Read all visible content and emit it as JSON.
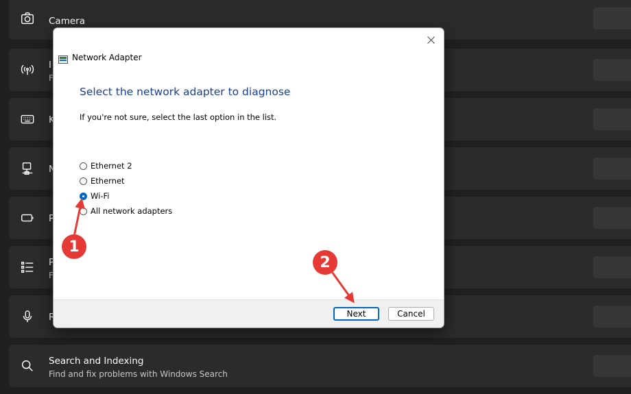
{
  "settings_rows": [
    {
      "title": "Camera",
      "subtitle": "",
      "icon": "camera-icon"
    },
    {
      "title": "I",
      "subtitle": "F",
      "icon": "antenna-icon"
    },
    {
      "title": "K",
      "subtitle": "",
      "icon": "keyboard-icon"
    },
    {
      "title": "N",
      "subtitle": "",
      "icon": "network-adapter-icon"
    },
    {
      "title": "P",
      "subtitle": "",
      "icon": "power-icon"
    },
    {
      "title": "P",
      "subtitle": "F",
      "icon": "list-icon"
    },
    {
      "title": "R",
      "subtitle": "",
      "icon": "microphone-icon"
    },
    {
      "title": "Search and Indexing",
      "subtitle": "Find and fix problems with Windows Search",
      "icon": "search-icon"
    }
  ],
  "dialog": {
    "window_title": "Network Adapter",
    "heading": "Select the network adapter to diagnose",
    "description": "If you're not sure, select the last option in the list.",
    "options": [
      {
        "label": "Ethernet 2",
        "checked": false
      },
      {
        "label": "Ethernet",
        "checked": false
      },
      {
        "label": "Wi-Fi",
        "checked": true
      },
      {
        "label": "All network adapters",
        "checked": false
      }
    ],
    "next_label": "Next",
    "cancel_label": "Cancel"
  },
  "annotations": {
    "step1": "1",
    "step2": "2"
  },
  "colors": {
    "background": "#202020",
    "row": "#2b2b2b",
    "heading_blue": "#1b3f92",
    "accent": "#0067c0",
    "annotation_red": "#e53935"
  }
}
